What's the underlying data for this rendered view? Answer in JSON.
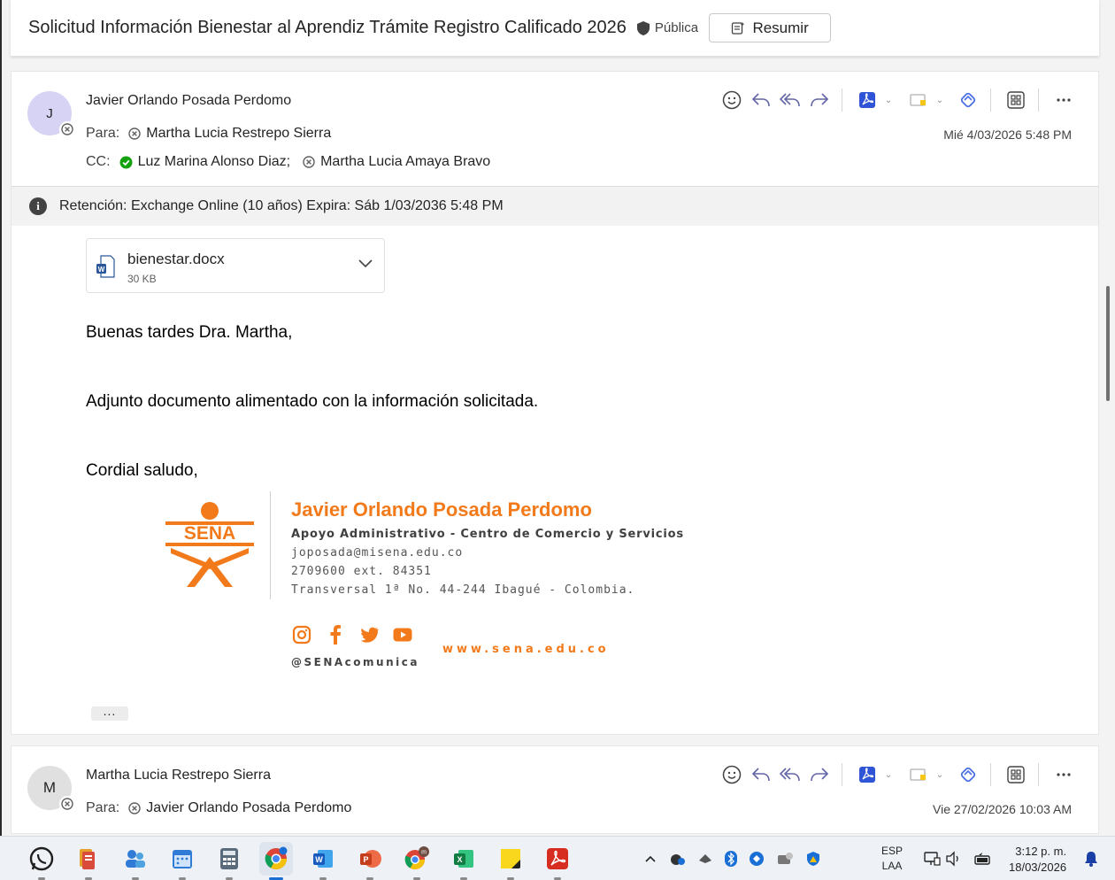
{
  "subject_bar": {
    "subject": "Solicitud Información Bienestar al Aprendiz Trámite Registro Calificado 2026",
    "sensitivity": "Pública",
    "summarize_label": "Resumir"
  },
  "messages": [
    {
      "avatar_initial": "J",
      "avatar_color": "#d7d3f5",
      "sender": "Javier Orlando Posada Perdomo",
      "to_label": "Para:",
      "to": [
        "Martha Lucia Restrepo Sierra"
      ],
      "cc_label": "CC:",
      "cc": [
        {
          "name": "Luz Marina Alonso Diaz;",
          "status": "available"
        },
        {
          "name": "Martha Lucia Amaya Bravo",
          "status": "offline"
        }
      ],
      "date": "Mié 4/03/2026 5:48 PM",
      "retention": "Retención: Exchange Online (10 años) Expira: Sáb 1/03/2036 5:48 PM",
      "attachment": {
        "name": "bienestar.docx",
        "size": "30 KB"
      },
      "body": [
        "Buenas tardes Dra. Martha,",
        "Adjunto documento alimentado con la información solicitada.",
        "Cordial saludo,"
      ],
      "signature": {
        "logo_text": "SENA",
        "name": "Javier Orlando Posada Perdomo",
        "role": "Apoyo Administrativo - Centro de Comercio y Servicios",
        "email": "joposada@misena.edu.co",
        "phone": "2709600 ext. 84351",
        "address": "Transversal 1ª No. 44-244 Ibagué - Colombia.",
        "handle": "@SENAcomunica",
        "website": "www.sena.edu.co"
      },
      "more_label": "..."
    },
    {
      "avatar_initial": "M",
      "avatar_color": "#e0e0e0",
      "sender": "Martha Lucia Restrepo Sierra",
      "to_label": "Para:",
      "to": [
        "Javier Orlando Posada Perdomo"
      ],
      "date": "Vie 27/02/2026 10:03 AM"
    }
  ],
  "colors": {
    "accent": "#6264a7",
    "sena_orange": "#f27a1a",
    "pdf_blue": "#2f54d6"
  },
  "taskbar": {
    "apps": [
      "whatsapp-icon",
      "notes-icon",
      "people-icon",
      "calendar-icon",
      "calculator-icon",
      "chrome-icon",
      "word-icon",
      "powerpoint-icon",
      "chrome-profile-icon",
      "excel-icon",
      "sticky-notes-icon",
      "acrobat-icon"
    ],
    "language_top": "ESP",
    "language_bottom": "LAA",
    "time": "3:12 p. m.",
    "date": "18/03/2026"
  }
}
